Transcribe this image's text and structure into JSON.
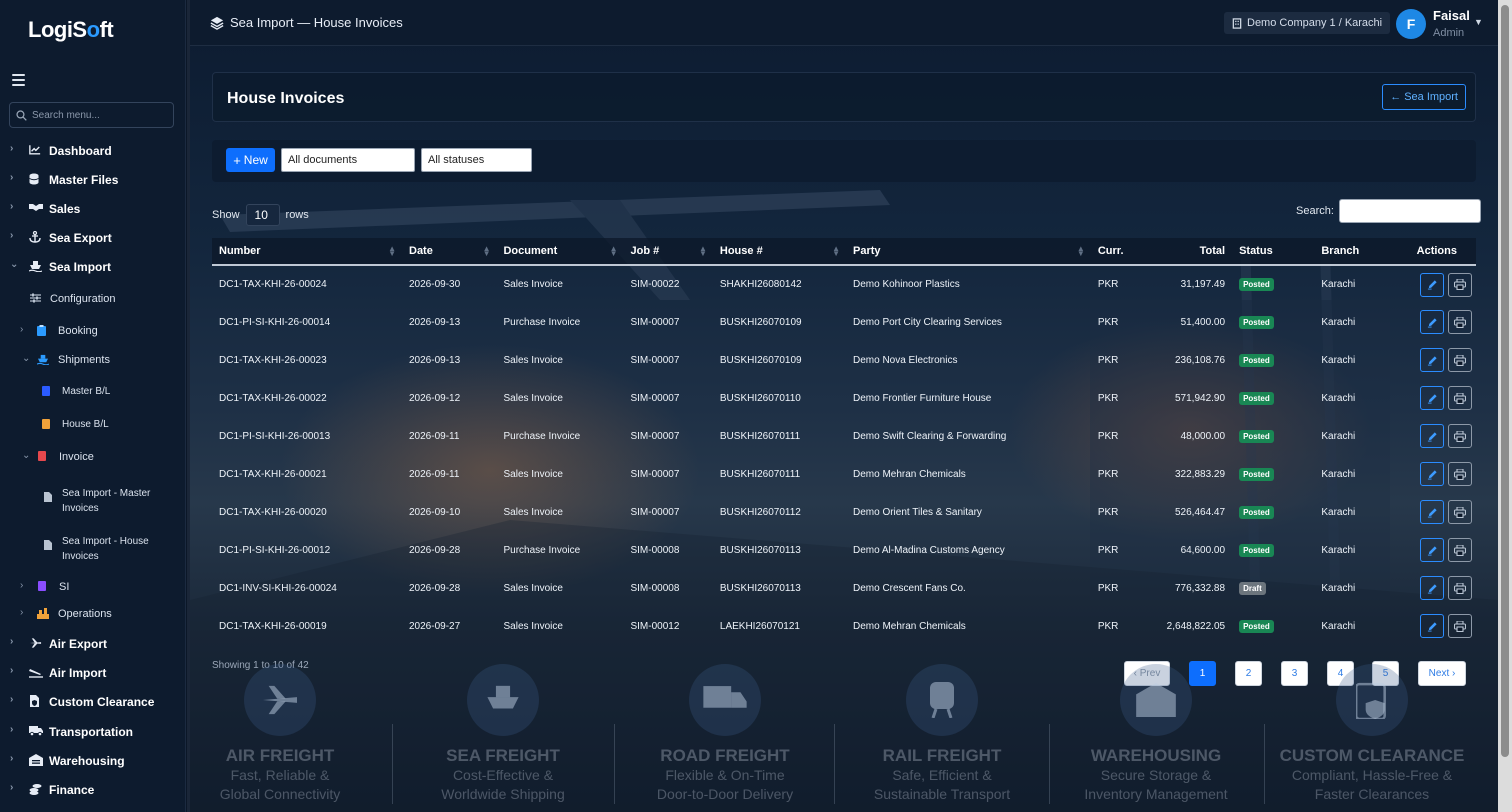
{
  "app": {
    "logo_text_a": "LogiS",
    "logo_text_b": "o",
    "logo_text_c": "ft",
    "breadcrumb": "Sea Import — House Invoices",
    "company": "Demo Company 1 / Karachi",
    "user": {
      "initial": "F",
      "name": "Faisal",
      "role": "Admin"
    }
  },
  "sidebar": {
    "search_placeholder": "Search menu...",
    "items": [
      {
        "label": "Dashboard",
        "icon": "chart-line-icon",
        "expanded": false
      },
      {
        "label": "Master Files",
        "icon": "database-icon",
        "expanded": false
      },
      {
        "label": "Sales",
        "icon": "handshake-icon",
        "expanded": false
      },
      {
        "label": "Sea Export",
        "icon": "anchor-icon",
        "expanded": false
      },
      {
        "label": "Sea Import",
        "icon": "ship-icon",
        "expanded": true
      },
      {
        "label": "Configuration",
        "icon": "sliders-icon"
      },
      {
        "label": "Booking",
        "icon": "clipboard-icon"
      },
      {
        "label": "Shipments",
        "icon": "ship-icon"
      },
      {
        "label": "Master B/L",
        "icon": "file-icon"
      },
      {
        "label": "House B/L",
        "icon": "file-icon"
      },
      {
        "label": "Invoice",
        "icon": "file-invoice-icon"
      },
      {
        "label": "Sea Import - Master Invoices",
        "icon": "file-icon"
      },
      {
        "label": "Sea Import - House Invoices",
        "icon": "file-icon"
      },
      {
        "label": "SI",
        "icon": "file-icon"
      },
      {
        "label": "Operations",
        "icon": "operations-icon"
      },
      {
        "label": "Air Export",
        "icon": "plane-icon"
      },
      {
        "label": "Air Import",
        "icon": "plane-arrival-icon"
      },
      {
        "label": "Custom Clearance",
        "icon": "file-shield-icon"
      },
      {
        "label": "Transportation",
        "icon": "truck-icon"
      },
      {
        "label": "Warehousing",
        "icon": "warehouse-icon"
      },
      {
        "label": "Finance",
        "icon": "coins-icon"
      }
    ],
    "invoice_sub": {
      "master_line1": "Sea Import - Master",
      "master_line2": "Invoices",
      "house_line1": "Sea Import - House",
      "house_line2": "Invoices"
    }
  },
  "page": {
    "title": "House Invoices",
    "back_label": "Sea Import",
    "new_label": "New",
    "filter_documents": "All documents",
    "filter_statuses": "All statuses",
    "show_label": "Show",
    "page_length": "10",
    "rows_label": "rows",
    "search_label": "Search:",
    "showing_text": "Showing 1 to 10 of 42"
  },
  "table": {
    "headers": [
      "Number",
      "Date",
      "Document",
      "Job #",
      "House #",
      "Party",
      "Curr.",
      "Total",
      "Status",
      "Branch",
      "Actions"
    ],
    "rows": [
      [
        "DC1-TAX-KHI-26-00024",
        "2026-09-30",
        "Sales Invoice",
        "SIM-00022",
        "SHAKHI26080142",
        "Demo Kohinoor Plastics",
        "PKR",
        "31,197.49",
        "Posted",
        "Karachi"
      ],
      [
        "DC1-PI-SI-KHI-26-00014",
        "2026-09-13",
        "Purchase Invoice",
        "SIM-00007",
        "BUSKHI26070109",
        "Demo Port City Clearing Services",
        "PKR",
        "51,400.00",
        "Posted",
        "Karachi"
      ],
      [
        "DC1-TAX-KHI-26-00023",
        "2026-09-13",
        "Sales Invoice",
        "SIM-00007",
        "BUSKHI26070109",
        "Demo Nova Electronics",
        "PKR",
        "236,108.76",
        "Posted",
        "Karachi"
      ],
      [
        "DC1-TAX-KHI-26-00022",
        "2026-09-12",
        "Sales Invoice",
        "SIM-00007",
        "BUSKHI26070110",
        "Demo Frontier Furniture House",
        "PKR",
        "571,942.90",
        "Posted",
        "Karachi"
      ],
      [
        "DC1-PI-SI-KHI-26-00013",
        "2026-09-11",
        "Purchase Invoice",
        "SIM-00007",
        "BUSKHI26070111",
        "Demo Swift Clearing & Forwarding",
        "PKR",
        "48,000.00",
        "Posted",
        "Karachi"
      ],
      [
        "DC1-TAX-KHI-26-00021",
        "2026-09-11",
        "Sales Invoice",
        "SIM-00007",
        "BUSKHI26070111",
        "Demo Mehran Chemicals",
        "PKR",
        "322,883.29",
        "Posted",
        "Karachi"
      ],
      [
        "DC1-TAX-KHI-26-00020",
        "2026-09-10",
        "Sales Invoice",
        "SIM-00007",
        "BUSKHI26070112",
        "Demo Orient Tiles & Sanitary",
        "PKR",
        "526,464.47",
        "Posted",
        "Karachi"
      ],
      [
        "DC1-PI-SI-KHI-26-00012",
        "2026-09-28",
        "Purchase Invoice",
        "SIM-00008",
        "BUSKHI26070113",
        "Demo Al-Madina Customs Agency",
        "PKR",
        "64,600.00",
        "Posted",
        "Karachi"
      ],
      [
        "DC1-INV-SI-KHI-26-00024",
        "2026-09-28",
        "Sales Invoice",
        "SIM-00008",
        "BUSKHI26070113",
        "Demo Crescent Fans Co.",
        "PKR",
        "776,332.88",
        "Draft",
        "Karachi"
      ],
      [
        "DC1-TAX-KHI-26-00019",
        "2026-09-27",
        "Sales Invoice",
        "SIM-00012",
        "LAEKHI26070121",
        "Demo Mehran Chemicals",
        "PKR",
        "2,648,822.05",
        "Posted",
        "Karachi"
      ]
    ]
  },
  "pagination": {
    "prev": "‹ Prev",
    "pages": [
      "1",
      "2",
      "3",
      "4",
      "5"
    ],
    "current": "1",
    "next": "Next ›"
  },
  "services": [
    {
      "title": "AIR FREIGHT",
      "line1": "Fast, Reliable &",
      "line2": "Global Connectivity",
      "icon": "plane-icon"
    },
    {
      "title": "SEA FREIGHT",
      "line1": "Cost-Effective &",
      "line2": "Worldwide Shipping",
      "icon": "ship-icon"
    },
    {
      "title": "ROAD FREIGHT",
      "line1": "Flexible & On-Time",
      "line2": "Door-to-Door Delivery",
      "icon": "truck-icon"
    },
    {
      "title": "RAIL FREIGHT",
      "line1": "Safe, Efficient &",
      "line2": "Sustainable Transport",
      "icon": "train-icon"
    },
    {
      "title": "WAREHOUSING",
      "line1": "Secure Storage &",
      "line2": "Inventory Management",
      "icon": "warehouse-icon"
    },
    {
      "title": "CUSTOM CLEARANCE",
      "line1": "Compliant, Hassle-Free &",
      "line2": "Faster Clearances",
      "icon": "clipboard-shield-icon"
    }
  ],
  "colors": {
    "accent": "#0d6efd",
    "posted": "#198754",
    "draft": "#6c757d",
    "sidebar_bg": "#0d1b2e"
  }
}
